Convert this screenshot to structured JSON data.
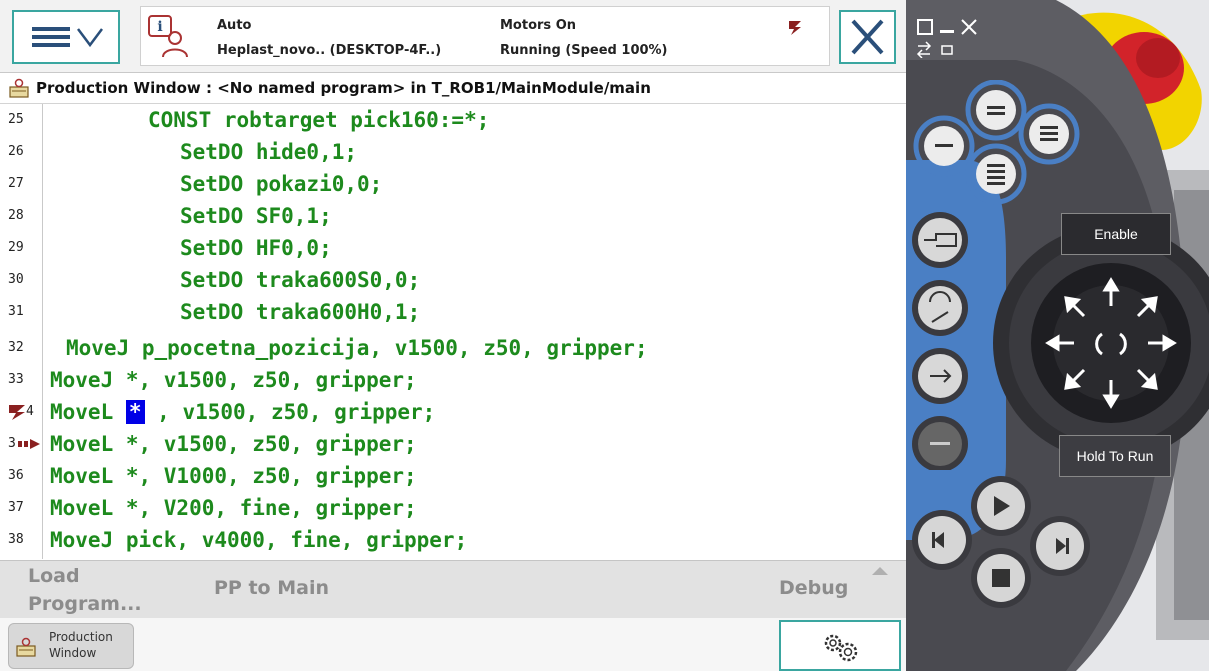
{
  "topbar": {
    "mode": "Auto",
    "system": "Heplast_novo.. (DESKTOP-4F..)",
    "motors": "Motors On",
    "running": "Running (Speed 100%)"
  },
  "window_title": "Production Window : <No named program> in T_ROB1/MainModule/main",
  "code_lines": [
    {
      "num": "25",
      "text": "CONST robtarget pick160:=*;"
    },
    {
      "num": "26",
      "text": "SetDO hide0,1;"
    },
    {
      "num": "27",
      "text": "SetDO pokazi0,0;"
    },
    {
      "num": "28",
      "text": "SetDO SF0,1;"
    },
    {
      "num": "29",
      "text": "SetDO HF0,0;"
    },
    {
      "num": "30",
      "text": "SetDO traka600S0,0;"
    },
    {
      "num": "31",
      "text": "SetDO traka600H0,1;"
    },
    {
      "num": "32",
      "text": "MoveJ p_pocetna_pozicija, v1500, z50, gripper;"
    },
    {
      "num": "33",
      "text": "MoveJ *, v1500, z50, gripper;"
    },
    {
      "num": "4",
      "pre": "MoveL ",
      "sel": "*",
      "post": " , v1500, z50, gripper;"
    },
    {
      "num": "3",
      "text": "MoveL *, v1500, z50, gripper;"
    },
    {
      "num": "36",
      "text": "MoveL *, V1000, z50, gripper;"
    },
    {
      "num": "37",
      "text": "MoveL *, V200, fine, gripper;"
    },
    {
      "num": "38",
      "text": "MoveJ pick, v4000, fine, gripper;"
    }
  ],
  "commands": {
    "load_line1": "Load",
    "load_line2": "Program...",
    "pp_main": "PP to Main",
    "debug": "Debug"
  },
  "taskbar": {
    "item_line1": "Production",
    "item_line2": "Window"
  },
  "pendant": {
    "enable": "Enable",
    "hold": "Hold To Run"
  },
  "colors": {
    "code_green": "#1d8a1d",
    "selection_blue": "#0000e6",
    "accent_teal": "#3aa6a0",
    "pendant_blue": "#4a7fc4",
    "emergency_red": "#d2232a",
    "guard_yellow": "#f2d400"
  },
  "icons": {
    "menu": "hamburger-chevron-icon",
    "info": "info-user-icon",
    "close": "close-x-icon",
    "program_pointer": "program-pointer-icon",
    "motion_pointer": "motion-pointer-arrow-icon",
    "quickset": "gears-icon"
  }
}
